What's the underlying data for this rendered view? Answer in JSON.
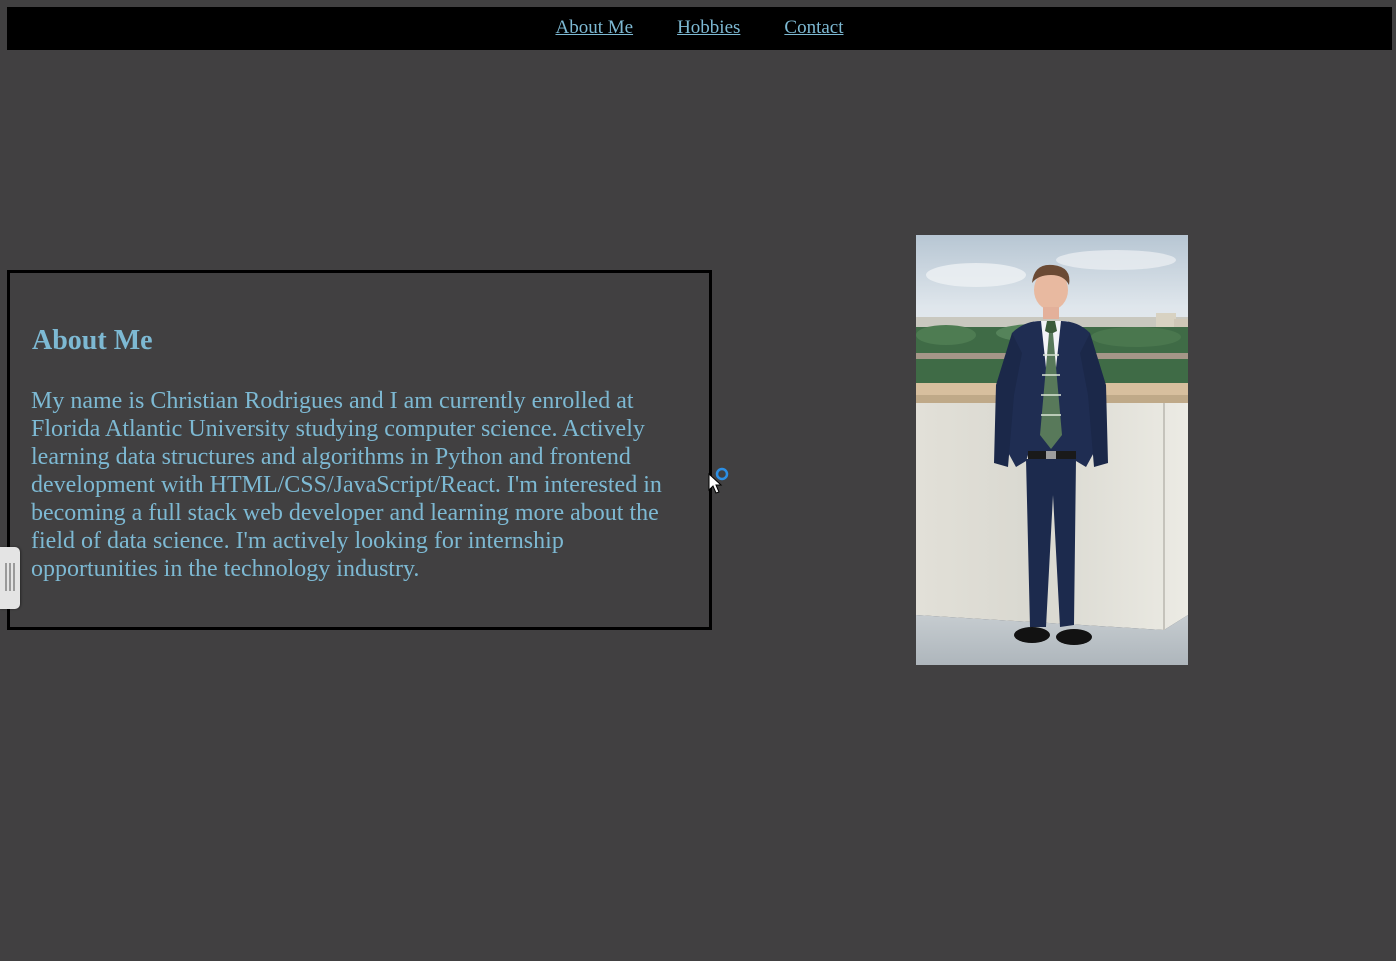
{
  "nav": {
    "items": [
      {
        "label": "About Me"
      },
      {
        "label": "Hobbies"
      },
      {
        "label": "Contact"
      }
    ]
  },
  "about": {
    "title": "About Me",
    "body": "My name is Christian Rodrigues and I am currently enrolled at Florida Atlantic University studying computer science. Actively learning data structures and algorithms in Python and frontend development with HTML/CSS/JavaScript/React. I'm interested in becoming a full stack web developer and learning more about the field of data science. I'm actively looking for internship opportunities in the technology industry."
  },
  "colors": {
    "background": "#414041",
    "navbar": "#000000",
    "text_accent": "#7db9d3"
  },
  "icons": {
    "cursor": "mouse-pointer-icon",
    "side_handle": "drawer-handle-icon"
  }
}
